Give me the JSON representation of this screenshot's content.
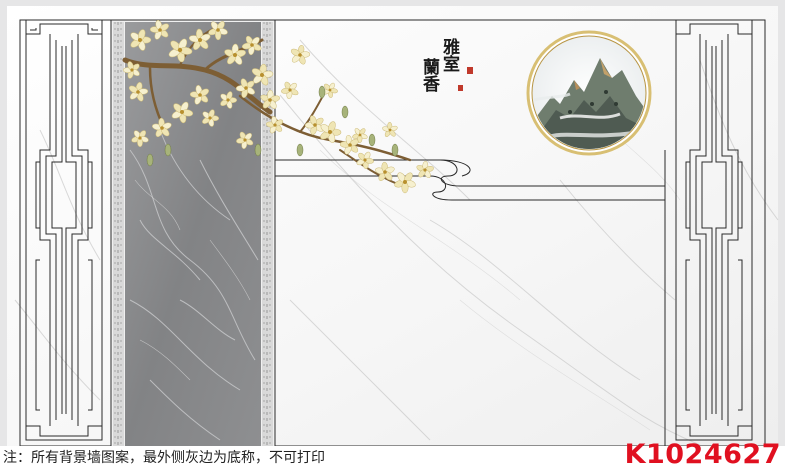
{
  "artwork": {
    "poem_right": "雅室",
    "poem_left": "蘭香",
    "seal_mark": "印",
    "colors": {
      "wall": "#f7f7f7",
      "marble_panel": "#8a8b8d",
      "frame_line": "#2a2a2a",
      "blossom": "#f3ecc8",
      "branch": "#8a6a3a",
      "seal": "#c0392b",
      "ring": "#c9a24a"
    }
  },
  "footer": {
    "note": "注：所有背景墙图案，最外侧灰边为底称，不可打印",
    "code": "K1024627"
  }
}
